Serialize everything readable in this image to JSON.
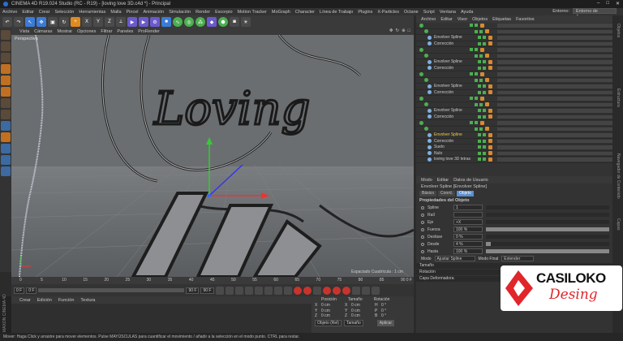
{
  "title_bar": {
    "title": "CINEMA 4D R19.024 Studio (RC - R19) - [loving love 3D.c4d *] - Principal"
  },
  "menu": {
    "items": [
      "Archivo",
      "Editar",
      "Crear",
      "Selección",
      "Herramientas",
      "Malla",
      "Pincel",
      "Animación",
      "Simulación",
      "Render",
      "Escorpio",
      "Motion Tracker",
      "MoGraph",
      "Character",
      "Línea de Trabajo",
      "Plugins",
      "X-Particles",
      "Octane",
      "Script",
      "Ventana",
      "Ayuda"
    ],
    "env_label": "Entorno:",
    "env_value": "Entorno de Arranque"
  },
  "viewport": {
    "menu": [
      "Vista",
      "Cámaras",
      "Mostrar",
      "Opciones",
      "Filtrar",
      "Paneles",
      "ProRender"
    ],
    "label": "Perspectiva",
    "grid_info": "Espaciado Cuadrícula : 1 cm",
    "lettering": "Loving"
  },
  "timeline": {
    "ticks": [
      "0",
      "5",
      "10",
      "15",
      "20",
      "25",
      "30",
      "35",
      "40",
      "45",
      "50",
      "55",
      "60",
      "65",
      "70",
      "75",
      "80",
      "85",
      "90"
    ],
    "frame_end": "0 F",
    "start": "0 F",
    "start2": "0 F",
    "end": "90 F",
    "end2": "90 F"
  },
  "material": {
    "menu": [
      "Crear",
      "Edición",
      "Función",
      "Textura"
    ]
  },
  "coords": {
    "headers": [
      "Posición",
      "Tamaño",
      "Rotación"
    ],
    "rows": [
      {
        "axis": "X",
        "pos": "0 cm",
        "size": "0 cm",
        "rot_label": "H",
        "rot": "0 °"
      },
      {
        "axis": "Y",
        "pos": "0 cm",
        "size": "0 cm",
        "rot_label": "P",
        "rot": "0 °"
      },
      {
        "axis": "Z",
        "pos": "0 cm",
        "size": "0 cm",
        "rot_label": "B",
        "rot": "0 °"
      }
    ],
    "mode": "Objeto (Rel)",
    "size_mode": "Tamaño",
    "apply": "Aplicar"
  },
  "objects": {
    "menu": [
      "Archivo",
      "Editar",
      "Visor",
      "Objetos",
      "Etiquetas",
      "Favoritos"
    ],
    "rows": [
      {
        "name": "",
        "selected": false
      },
      {
        "name": "",
        "selected": false
      },
      {
        "name": "Envolver Spline",
        "selected": false
      },
      {
        "name": "Corrección",
        "selected": false
      },
      {
        "name": "",
        "selected": false
      },
      {
        "name": "",
        "selected": false
      },
      {
        "name": "Envolver Spline",
        "selected": false
      },
      {
        "name": "Corrección",
        "selected": false
      },
      {
        "name": "",
        "selected": false
      },
      {
        "name": "",
        "selected": false
      },
      {
        "name": "Envolver Spline",
        "selected": false
      },
      {
        "name": "Corrección",
        "selected": false
      },
      {
        "name": "",
        "selected": false
      },
      {
        "name": "",
        "selected": false
      },
      {
        "name": "Envolver Spline",
        "selected": false
      },
      {
        "name": "Corrección",
        "selected": false
      },
      {
        "name": "",
        "selected": false
      },
      {
        "name": "",
        "selected": false
      },
      {
        "name": "Envolver Spline",
        "selected": true
      },
      {
        "name": "Corrección",
        "selected": false
      },
      {
        "name": "Suelo",
        "selected": false
      },
      {
        "name": "Nulo",
        "selected": false
      },
      {
        "name": "loving love 3D letras",
        "selected": false
      }
    ]
  },
  "attributes": {
    "menu": [
      "Modo",
      "Editar",
      "Datos de Usuario"
    ],
    "object_name": "Envolver Spline [Envolver Spline]",
    "tabs": [
      "Básico",
      "Coord.",
      "Objeto"
    ],
    "section": "Propiedades del Objeto",
    "fields": [
      {
        "label": "Spline",
        "value": "1",
        "fill": 0
      },
      {
        "label": "Raíl",
        "value": "",
        "fill": 0
      },
      {
        "label": "Eje",
        "value": "+X",
        "fill": 0
      },
      {
        "label": "Fuerza",
        "value": "100 %",
        "fill": 1.0
      },
      {
        "label": "Desfase",
        "value": "0 %",
        "fill": 0.0
      },
      {
        "label": "Desde",
        "value": "4 %",
        "fill": 0.04
      },
      {
        "label": "Hasta",
        "value": "100 %",
        "fill": 1.0
      }
    ],
    "mode_label": "Modo",
    "mode_value": "Ajustar Spline",
    "final_mode_label": "Modo Final",
    "final_mode_value": "Extender",
    "sections": [
      "Tamaño",
      "Rotación",
      "Capa Deformadora"
    ]
  },
  "right_tabs": [
    "Objetos",
    "Estructura",
    "Navegador de Contenido",
    "Capas"
  ],
  "status": "Mover: Haga Click y arrastre para mover elementos. Pulse MAYÚSCULAS para cuantificar el movimiento / añadir a la selección en el modo punto. CTRL para restar.",
  "brand": {
    "top": "CASILOKO",
    "bottom": "Desing",
    "accent": "#e0252b"
  },
  "side_brand": "MAXON CINEMA 4D"
}
